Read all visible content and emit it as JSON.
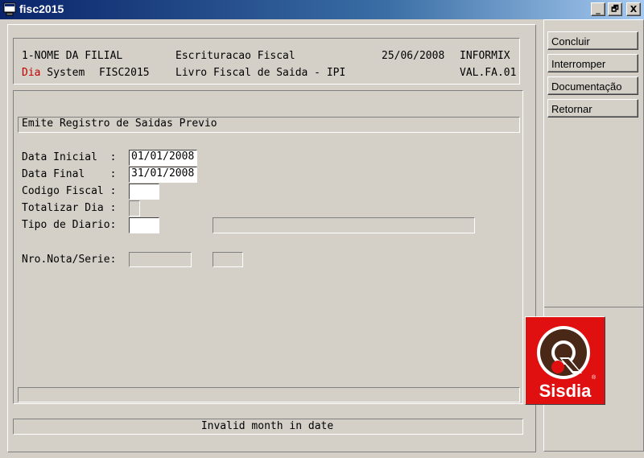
{
  "window": {
    "title": "fisc2015",
    "minimize": "_",
    "restore": "🗗",
    "close": "X"
  },
  "header": {
    "line1": {
      "filial": "1-NOME DA FILIAL",
      "module": "Escrituracao Fiscal",
      "date": "25/06/2008",
      "db": "INFORMIX"
    },
    "line2": {
      "brand_a": "Dia",
      "brand_b": " System",
      "program": "FISC2015",
      "report": "Livro Fiscal de Saida - IPI",
      "version": "VAL.FA.01"
    }
  },
  "form": {
    "subtitle": "Emite Registro de Saidas Previo",
    "fields": [
      {
        "label": "Data Inicial  :",
        "value": "01/01/2008"
      },
      {
        "label": "Data Final    :",
        "value": "31/01/2008"
      },
      {
        "label": "Codigo Fiscal :",
        "value": ""
      },
      {
        "label": "Totalizar Dia :",
        "value": ""
      },
      {
        "label": "Tipo de Diario:",
        "value": "",
        "extra": ""
      },
      {
        "label": "Nro.Nota/Serie:",
        "value": "",
        "serie": ""
      }
    ]
  },
  "status": {
    "message": "Invalid month in date"
  },
  "sidebar": {
    "buttons": [
      "Concluir",
      "Interromper",
      "Documentação",
      "Retornar"
    ]
  },
  "logo": {
    "text": "Sisdia",
    "reg": "®",
    "colors": {
      "red": "#e01010",
      "brown": "#4a2818"
    }
  }
}
